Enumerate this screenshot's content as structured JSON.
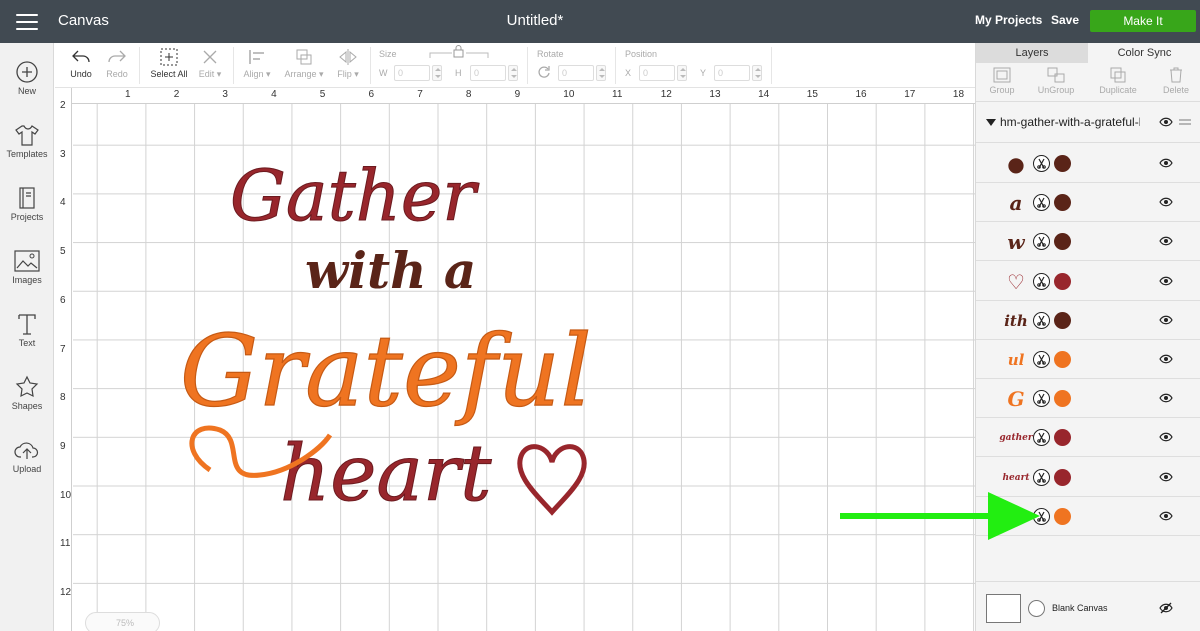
{
  "header": {
    "app_name": "Canvas",
    "doc_title": "Untitled*",
    "my_projects": "My Projects",
    "save": "Save",
    "make_it": "Make It"
  },
  "sidebar": {
    "items": [
      {
        "label": "New",
        "icon": "plus-circle-icon"
      },
      {
        "label": "Templates",
        "icon": "tshirt-icon"
      },
      {
        "label": "Projects",
        "icon": "book-icon"
      },
      {
        "label": "Images",
        "icon": "image-icon"
      },
      {
        "label": "Text",
        "icon": "text-icon"
      },
      {
        "label": "Shapes",
        "icon": "shapes-icon"
      },
      {
        "label": "Upload",
        "icon": "upload-cloud-icon"
      }
    ]
  },
  "toolbar": {
    "undo": "Undo",
    "redo": "Redo",
    "select_all": "Select All",
    "edit": "Edit",
    "align": "Align",
    "arrange": "Arrange",
    "flip": "Flip",
    "size": "Size",
    "w": "W",
    "h": "H",
    "w_value": "0",
    "h_value": "0",
    "rotate": "Rotate",
    "rotate_value": "0",
    "position": "Position",
    "x": "X",
    "y": "Y",
    "x_value": "0",
    "y_value": "0"
  },
  "ruler": {
    "top": [
      "1",
      "2",
      "3",
      "4",
      "5",
      "6",
      "7",
      "8",
      "9",
      "10",
      "11",
      "12",
      "13",
      "14",
      "15",
      "16",
      "17",
      "18"
    ],
    "left": [
      "2",
      "3",
      "4",
      "5",
      "6",
      "7",
      "8",
      "9",
      "10",
      "11",
      "12"
    ]
  },
  "design": {
    "line1": "Gather",
    "line2": "with a",
    "line3": "Grateful",
    "line4": "heart"
  },
  "zoom": {
    "value": "75%"
  },
  "panel": {
    "tabs": {
      "layers": "Layers",
      "color_sync": "Color Sync"
    },
    "actions": {
      "group": "Group",
      "ungroup": "UnGroup",
      "duplicate": "Duplicate",
      "delete": "Delete"
    },
    "group_name": "hm-gather-with-a-grateful-heart",
    "layers": [
      {
        "thumb": "●",
        "color": "#5a2418"
      },
      {
        "thumb": "a",
        "color": "#5a2418"
      },
      {
        "thumb": "w",
        "color": "#5a2418"
      },
      {
        "thumb": "♡",
        "color": "#98262c"
      },
      {
        "thumb": "ith",
        "color": "#5a2418"
      },
      {
        "thumb": "ul",
        "color": "#ef7421"
      },
      {
        "thumb": "G",
        "color": "#ef7421"
      },
      {
        "thumb": "gather",
        "color": "#98262c"
      },
      {
        "thumb": "heart",
        "color": "#98262c"
      },
      {
        "thumb": "",
        "color": "#ef7421"
      }
    ],
    "blank_canvas": "Blank Canvas"
  },
  "colors": {
    "topbar": "#414a52",
    "make_it": "#38a61a",
    "dark_brown": "#5a2418",
    "red": "#98262c",
    "orange": "#ef7421",
    "arrow": "#22ee11"
  }
}
